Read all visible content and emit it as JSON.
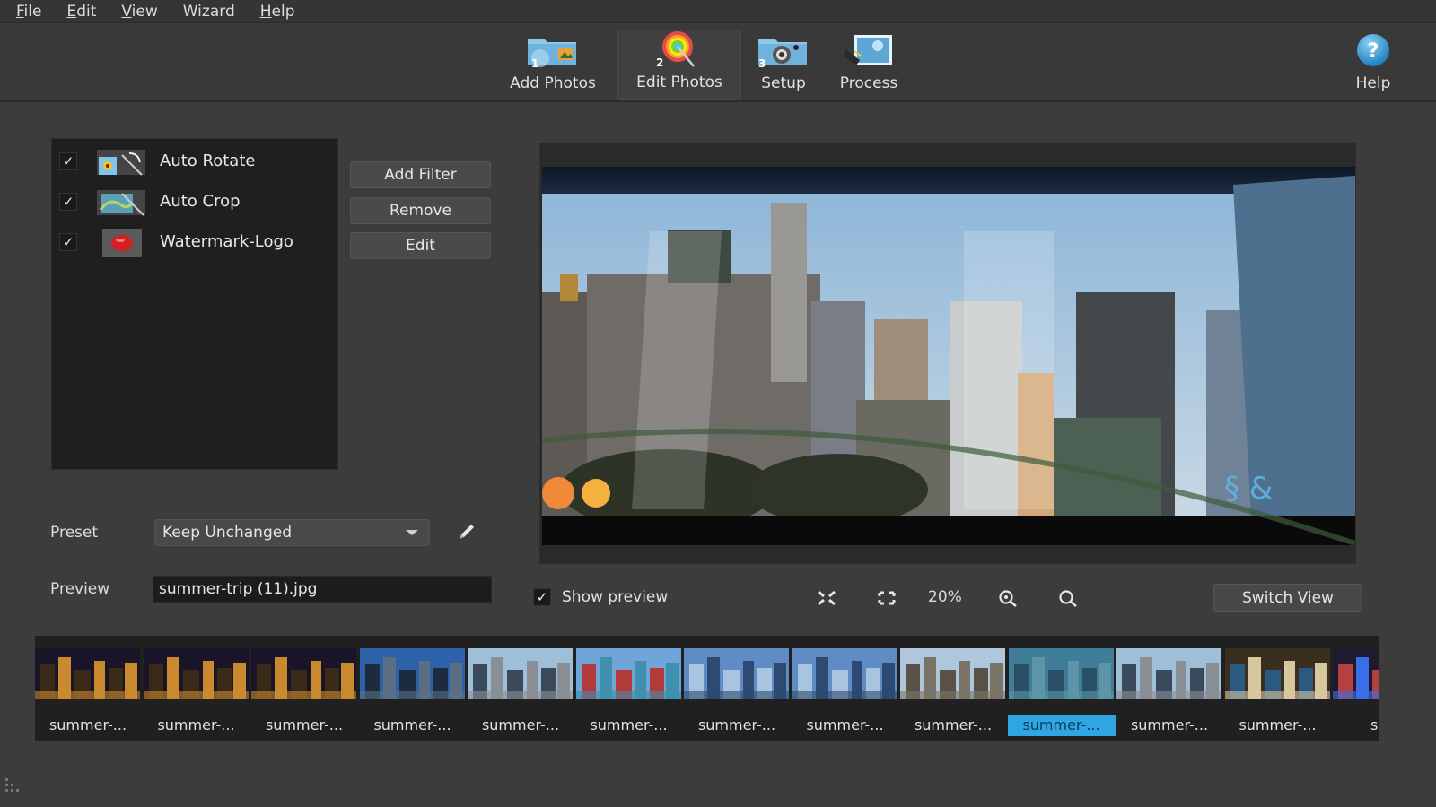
{
  "menu": {
    "items": [
      {
        "label": "File",
        "mnemonic": "F",
        "rest": "ile"
      },
      {
        "label": "Edit",
        "mnemonic": "E",
        "rest": "dit"
      },
      {
        "label": "View",
        "mnemonic": "V",
        "rest": "iew"
      },
      {
        "label": "Wizard",
        "mnemonic": "",
        "rest": "Wizard"
      },
      {
        "label": "Help",
        "mnemonic": "H",
        "rest": "elp"
      }
    ]
  },
  "toolbar": {
    "steps": [
      {
        "label": "Add Photos",
        "number": "1",
        "icon": "folder-photos-icon",
        "active": false
      },
      {
        "label": "Edit Photos",
        "number": "2",
        "icon": "color-wheel-wand-icon",
        "active": true
      },
      {
        "label": "Setup",
        "number": "3",
        "icon": "camera-gear-icon",
        "active": false
      },
      {
        "label": "Process",
        "number": "",
        "icon": "picture-process-icon",
        "active": false
      }
    ],
    "help_label": "Help",
    "help_icon": "help-icon"
  },
  "filters": {
    "items": [
      {
        "label": "Auto Rotate",
        "checked": true,
        "icon": "auto-rotate-icon"
      },
      {
        "label": "Auto Crop",
        "checked": true,
        "icon": "auto-crop-icon"
      },
      {
        "label": "Watermark-Logo",
        "checked": true,
        "icon": "watermark-logo-icon"
      }
    ],
    "check_glyph": "✓",
    "add_filter_label": "Add Filter",
    "remove_label": "Remove",
    "edit_label": "Edit"
  },
  "preset": {
    "label": "Preset",
    "value": "Keep Unchanged"
  },
  "preview": {
    "label": "Preview",
    "filename": "summer-trip (11).jpg"
  },
  "preview_controls": {
    "show_preview_label": "Show preview",
    "show_preview_checked": true,
    "zoom_level": "20%",
    "switch_view_label": "Switch View"
  },
  "filmstrip": {
    "items": [
      {
        "label": "summer-...",
        "selected": false,
        "tone": "night"
      },
      {
        "label": "summer-...",
        "selected": false,
        "tone": "night"
      },
      {
        "label": "summer-...",
        "selected": false,
        "tone": "night"
      },
      {
        "label": "summer-...",
        "selected": false,
        "tone": "blue"
      },
      {
        "label": "summer-...",
        "selected": false,
        "tone": "day"
      },
      {
        "label": "summer-...",
        "selected": false,
        "tone": "water"
      },
      {
        "label": "summer-...",
        "selected": false,
        "tone": "skyline"
      },
      {
        "label": "summer-...",
        "selected": false,
        "tone": "skyline"
      },
      {
        "label": "summer-...",
        "selected": false,
        "tone": "aerial"
      },
      {
        "label": "summer-...",
        "selected": true,
        "tone": "teal"
      },
      {
        "label": "summer-...",
        "selected": false,
        "tone": "day"
      },
      {
        "label": "summer-...",
        "selected": false,
        "tone": "tunnel"
      },
      {
        "label": "sum",
        "selected": false,
        "tone": "neon"
      }
    ]
  },
  "colors": {
    "selection": "#2fa6e3",
    "background": "#3c3c3c",
    "panel": "#1f1f1f"
  }
}
